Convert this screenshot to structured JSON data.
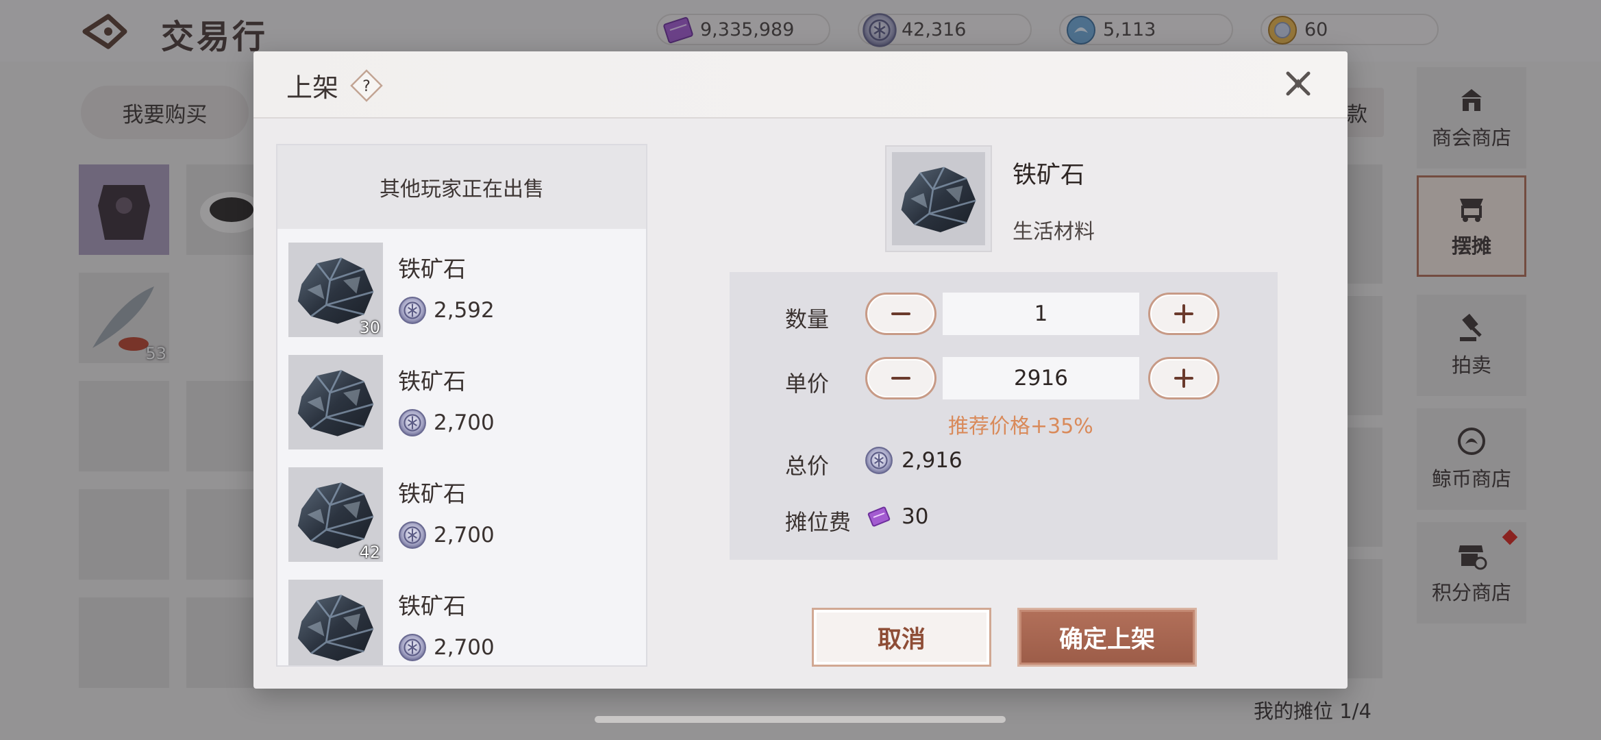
{
  "app": {
    "title": "交易行"
  },
  "currencies": [
    {
      "icon": "ticket-currency-icon",
      "value": "9,335,989"
    },
    {
      "icon": "silver-coin-icon",
      "value": "42,316"
    },
    {
      "icon": "whale-coin-icon",
      "value": "5,113"
    },
    {
      "icon": "gold-token-icon",
      "value": "60"
    }
  ],
  "buy_tab": {
    "label": "我要购买"
  },
  "inventory": [
    {
      "icon": "armor-item-icon",
      "count": ""
    },
    {
      "icon": "food-dish-item-icon",
      "count": ""
    },
    {
      "icon": "fish-item-icon",
      "count": "53"
    }
  ],
  "side_nav": {
    "items": [
      {
        "label": "商会商店",
        "icon": "guild-shop-icon"
      },
      {
        "label": "摆摊",
        "icon": "stall-cart-icon"
      },
      {
        "label": "拍卖",
        "icon": "auction-hammer-icon"
      },
      {
        "label": "鲸币商店",
        "icon": "whale-coin-shop-icon"
      },
      {
        "label": "积分商店",
        "icon": "points-shop-icon"
      }
    ],
    "active": "摆摊",
    "partial_right_button": "款"
  },
  "footer": {
    "my_stall": "我的摊位 1/4"
  },
  "modal": {
    "title": "上架",
    "help": "?",
    "others_selling": {
      "header": "其他玩家正在出售",
      "items": [
        {
          "name": "铁矿石",
          "price": "2,592",
          "qty": "30"
        },
        {
          "name": "铁矿石",
          "price": "2,700",
          "qty": ""
        },
        {
          "name": "铁矿石",
          "price": "2,700",
          "qty": "42"
        },
        {
          "name": "铁矿石",
          "price": "2,700",
          "qty": ""
        }
      ]
    },
    "item": {
      "name": "铁矿石",
      "category": "生活材料",
      "icon": "iron-ore-icon"
    },
    "form": {
      "quantity_label": "数量",
      "quantity_value": "1",
      "unit_price_label": "单价",
      "unit_price_value": "2916",
      "recommend_hint": "推荐价格+35%",
      "total_label": "总价",
      "total_value": "2,916",
      "fee_label": "摊位费",
      "fee_value": "30"
    },
    "buttons": {
      "cancel": "取消",
      "confirm": "确定上架"
    }
  },
  "colors": {
    "accent": "#a4644f",
    "hint": "#d98a5a",
    "notice_dot": "#d8261e"
  }
}
